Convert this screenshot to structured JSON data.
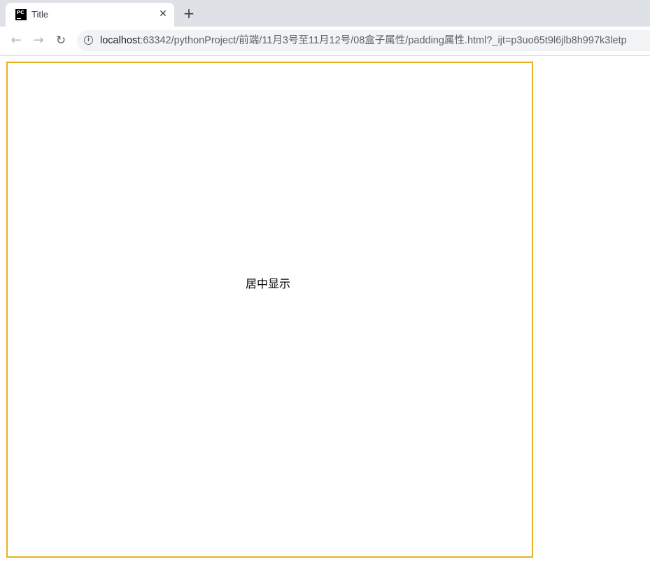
{
  "tab": {
    "title": "Title",
    "favicon_text": "PC",
    "close_glyph": "✕"
  },
  "new_tab_glyph": "+",
  "toolbar": {
    "back_glyph": "←",
    "forward_glyph": "→",
    "reload_glyph": "↻",
    "info_glyph": "i",
    "url_host": "localhost",
    "url_rest": ":63342/pythonProject/前端/11月3号至11月12号/08盒子属性/padding属性.html?_ijt=p3uo65t9l6jlb8h997k3letp"
  },
  "page": {
    "centered_text": "居中显示",
    "box_border_color": "#e6b220"
  }
}
